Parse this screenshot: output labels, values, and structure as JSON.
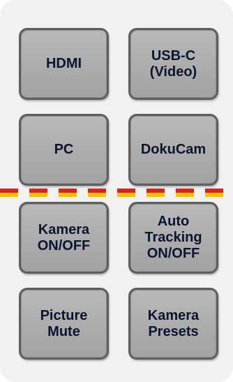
{
  "buttons": {
    "hdmi": "HDMI",
    "usbc": "USB-C\n(Video)",
    "pc": "PC",
    "dokucam": "DokuCam",
    "camera_onoff": "Kamera\nON/OFF",
    "auto_tracking": "Auto\nTracking\nON/OFF",
    "picture_mute": "Picture\nMute",
    "camera_presets": "Kamera\nPresets"
  },
  "colors": {
    "panel_background": "#f1f1f1",
    "button_fill": "#adadad",
    "button_border": "#5e5e5e",
    "button_text": "#0a1530",
    "divider_red": "#e31d1d",
    "divider_yellow": "#f5c400"
  }
}
